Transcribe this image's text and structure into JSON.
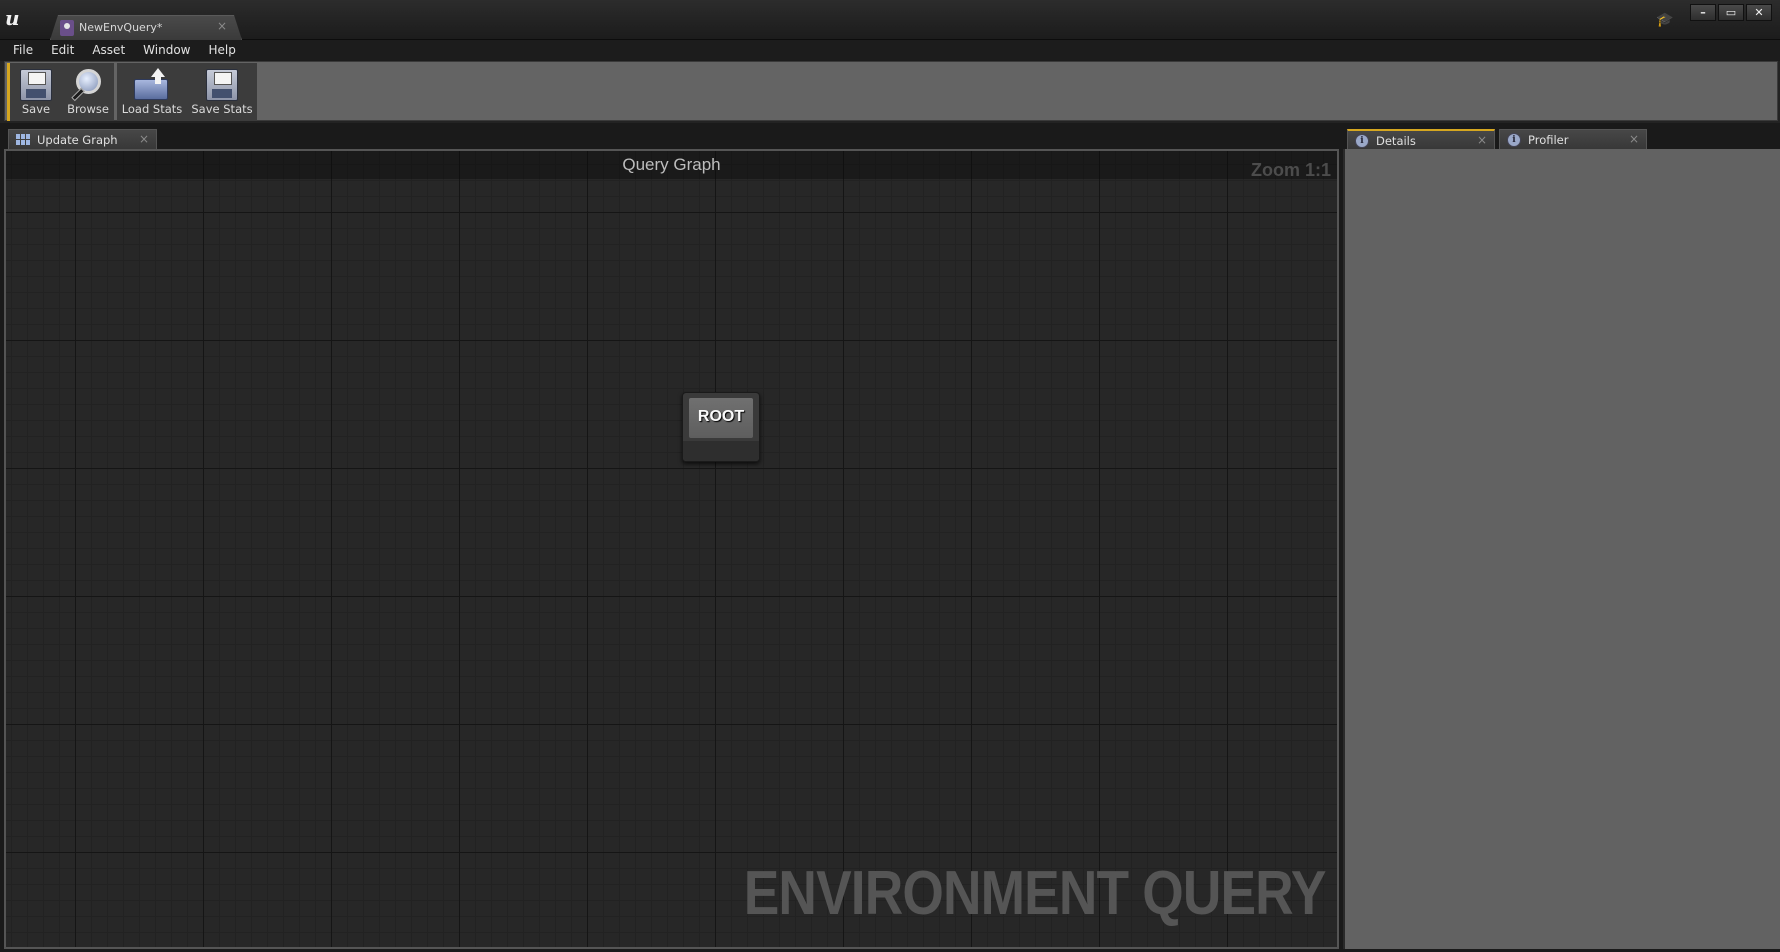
{
  "window": {
    "document_tab": "NewEnvQuery*",
    "close_glyph": "×",
    "controls": {
      "minimize": "–",
      "maximize": "▭",
      "close": "✕"
    },
    "logo_glyph": "u"
  },
  "menu": [
    "File",
    "Edit",
    "Asset",
    "Window",
    "Help"
  ],
  "toolbar": {
    "save": "Save",
    "browse": "Browse",
    "load_stats": "Load Stats",
    "save_stats": "Save Stats"
  },
  "tabs": {
    "update_graph": "Update Graph",
    "details": "Details",
    "profiler": "Profiler",
    "close_glyph": "×"
  },
  "graph": {
    "title": "Query Graph",
    "zoom": "Zoom 1:1",
    "watermark": "ENVIRONMENT QUERY",
    "root_node_label": "ROOT"
  },
  "colors": {
    "accent": "#d6a720",
    "details_bg": "#626262",
    "graph_bg": "#272727"
  }
}
